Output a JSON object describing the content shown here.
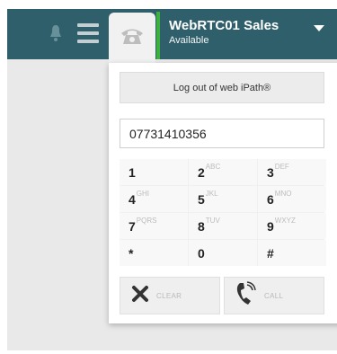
{
  "header": {
    "account_name": "WebRTC01 Sales",
    "account_status": "Available",
    "icons": [
      "bell-icon",
      "menu-icon",
      "phone-icon",
      "caret-down-icon"
    ],
    "accent_color": "#3db13d",
    "bar_color": "#2f5f6b"
  },
  "dialer": {
    "logout_label": "Log out of web iPath®",
    "number_value": "07731410356",
    "keys": [
      {
        "digit": "1",
        "letters": ""
      },
      {
        "digit": "2",
        "letters": "ABC"
      },
      {
        "digit": "3",
        "letters": "DEF"
      },
      {
        "digit": "4",
        "letters": "GHI"
      },
      {
        "digit": "5",
        "letters": "JKL"
      },
      {
        "digit": "6",
        "letters": "MNO"
      },
      {
        "digit": "7",
        "letters": "PQRS"
      },
      {
        "digit": "8",
        "letters": "TUV"
      },
      {
        "digit": "9",
        "letters": "WXYZ"
      },
      {
        "digit": "*",
        "letters": ""
      },
      {
        "digit": "0",
        "letters": ""
      },
      {
        "digit": "#",
        "letters": ""
      }
    ],
    "clear_label": "CLEAR",
    "call_label": "CALL"
  }
}
